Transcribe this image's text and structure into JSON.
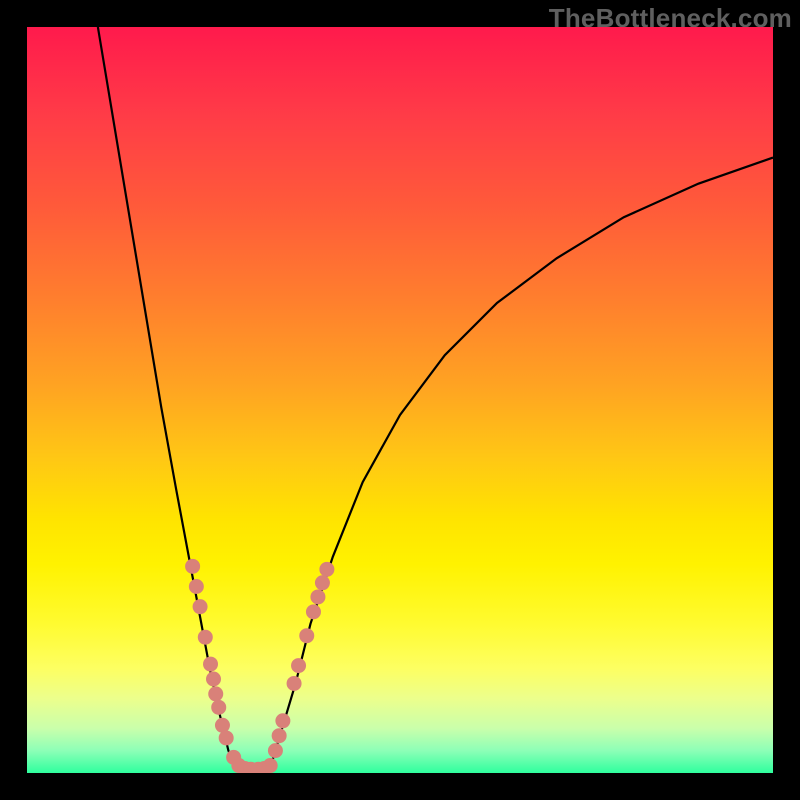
{
  "watermark": "TheBottleneck.com",
  "chart_data": {
    "type": "line",
    "title": "",
    "xlabel": "",
    "ylabel": "",
    "xlim": [
      0,
      100
    ],
    "ylim": [
      0,
      100
    ],
    "series": [
      {
        "name": "left-branch",
        "x": [
          9.5,
          10,
          12,
          14,
          16,
          18,
          20,
          21.5,
          23,
          24.5,
          25.8,
          27,
          28
        ],
        "y": [
          100,
          97,
          85,
          73,
          61,
          49,
          38,
          30,
          22,
          14,
          8,
          3,
          0.6
        ]
      },
      {
        "name": "right-branch",
        "x": [
          32.5,
          33,
          34.5,
          36,
          38,
          41,
          45,
          50,
          56,
          63,
          71,
          80,
          90,
          100
        ],
        "y": [
          0.6,
          2,
          7,
          12,
          20,
          29,
          39,
          48,
          56,
          63,
          69,
          74.5,
          79,
          82.5
        ]
      },
      {
        "name": "valley-floor",
        "x": [
          28,
          29.3,
          30.7,
          32.5
        ],
        "y": [
          0.6,
          0.4,
          0.4,
          0.6
        ]
      }
    ],
    "markers": {
      "name": "data-points",
      "points": [
        {
          "x": 22.2,
          "y": 27.7
        },
        {
          "x": 22.7,
          "y": 25.0
        },
        {
          "x": 23.2,
          "y": 22.3
        },
        {
          "x": 23.9,
          "y": 18.2
        },
        {
          "x": 24.6,
          "y": 14.6
        },
        {
          "x": 25.0,
          "y": 12.6
        },
        {
          "x": 25.3,
          "y": 10.6
        },
        {
          "x": 25.7,
          "y": 8.8
        },
        {
          "x": 26.2,
          "y": 6.4
        },
        {
          "x": 26.7,
          "y": 4.7
        },
        {
          "x": 27.7,
          "y": 2.1
        },
        {
          "x": 28.4,
          "y": 1.0
        },
        {
          "x": 29.2,
          "y": 0.6
        },
        {
          "x": 30.0,
          "y": 0.5
        },
        {
          "x": 31.0,
          "y": 0.5
        },
        {
          "x": 31.8,
          "y": 0.6
        },
        {
          "x": 32.6,
          "y": 1.0
        },
        {
          "x": 33.3,
          "y": 3.0
        },
        {
          "x": 33.8,
          "y": 5.0
        },
        {
          "x": 34.3,
          "y": 7.0
        },
        {
          "x": 35.8,
          "y": 12.0
        },
        {
          "x": 36.4,
          "y": 14.4
        },
        {
          "x": 37.5,
          "y": 18.4
        },
        {
          "x": 38.4,
          "y": 21.6
        },
        {
          "x": 39.0,
          "y": 23.6
        },
        {
          "x": 39.6,
          "y": 25.5
        },
        {
          "x": 40.2,
          "y": 27.3
        }
      ]
    },
    "gradient_stops": [
      {
        "pos": 0.0,
        "color": "#ff1a4c"
      },
      {
        "pos": 0.5,
        "color": "#ffc400"
      },
      {
        "pos": 0.82,
        "color": "#ffff40"
      },
      {
        "pos": 1.0,
        "color": "#2fff9e"
      }
    ]
  }
}
